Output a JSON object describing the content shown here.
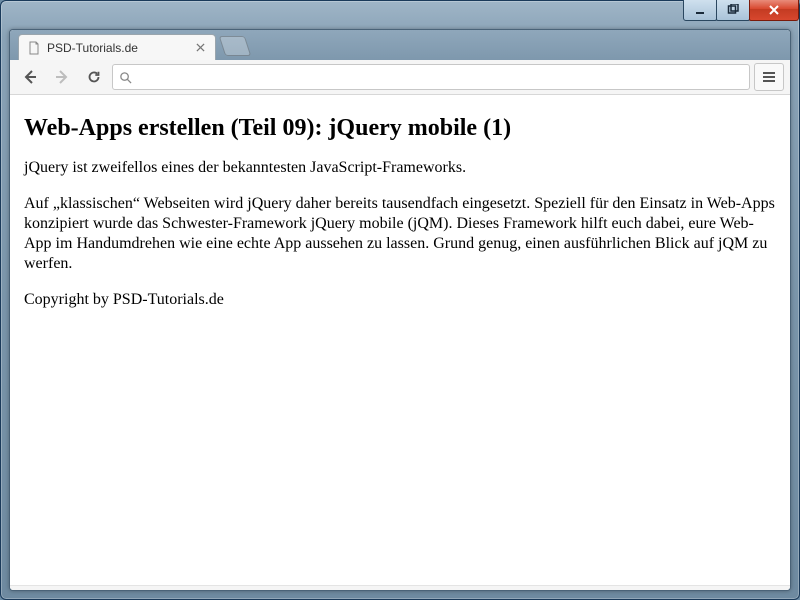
{
  "window": {
    "title": ""
  },
  "tab": {
    "title": "PSD-Tutorials.de"
  },
  "toolbar": {
    "url_value": "",
    "url_placeholder": ""
  },
  "page": {
    "heading": "Web-Apps erstellen (Teil 09): jQuery mobile (1)",
    "paragraph1": "jQuery ist zweifellos eines der bekanntesten JavaScript-Frameworks.",
    "paragraph2": "Auf „klassischen“ Webseiten wird jQuery daher bereits tausendfach eingesetzt. Speziell für den Einsatz in Web-Apps konzipiert wurde das Schwester-Framework jQuery mobile (jQM). Dieses Framework hilft euch dabei, eure Web-App im Handumdrehen wie eine echte App aussehen zu lassen. Grund genug, einen ausführlichen Blick auf jQM zu werfen.",
    "paragraph3": "Copyright by PSD-Tutorials.de"
  }
}
